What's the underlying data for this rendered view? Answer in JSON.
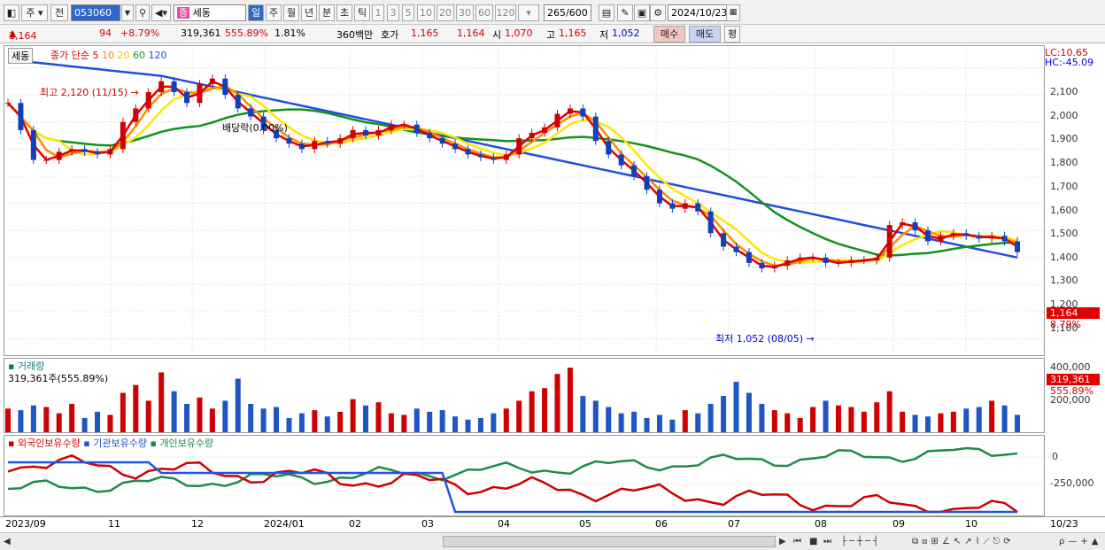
{
  "toolbar": {
    "period_type": "주",
    "prev": "전",
    "code": "053060",
    "name": "세동",
    "periods": [
      "일",
      "주",
      "월",
      "년",
      "분",
      "초",
      "틱"
    ],
    "numbers": [
      "1",
      "3",
      "5",
      "10",
      "20",
      "30",
      "60",
      "120"
    ],
    "count": "265",
    "count_total": "/600",
    "date": "2024/10/23"
  },
  "quote": {
    "price": "1,164",
    "change": "94",
    "change_pct": "+8.79%",
    "volume": "319,361",
    "volume_pct": "555.89%",
    "turnover": "1.81%",
    "amount": "360백만",
    "hoga_label": "호가",
    "ask": "1,165",
    "bid": "1,164",
    "open_label": "시",
    "open": "1,070",
    "high_label": "고",
    "high": "1,165",
    "low_label": "저",
    "low": "1,052",
    "buy": "매수",
    "sell": "매도",
    "avg": "평"
  },
  "price_panel": {
    "tab": "세동",
    "legend_label": "종가 단순",
    "ma": [
      "5",
      "10",
      "20",
      "60",
      "120"
    ],
    "ma_colors": [
      "#e00000",
      "#ff8c00",
      "#ffe600",
      "#12931e",
      "#1f4fe0"
    ],
    "lc": "LC:10.65",
    "hc": "HC:-45.09",
    "high_note": "최고 2,120 (11/15)",
    "low_note": "최저 1,052 (08/05)",
    "div_note": "배당락(0.00%)",
    "current_price": "1,164",
    "current_pct": "8.79%",
    "y_labels": [
      "2,100",
      "2,000",
      "1,900",
      "1,800",
      "1,700",
      "1,600",
      "1,500",
      "1,400",
      "1,300",
      "1,200",
      "1,100"
    ]
  },
  "volume_panel": {
    "title": "거래량",
    "value": "319,361주(555.89%)",
    "y_labels": [
      "400,000",
      "200,000"
    ],
    "current": "319,361",
    "current_pct": "555.89%"
  },
  "holding_panel": {
    "foreign": "외국인보유수량",
    "inst": "기관보유수량",
    "indiv": "개인보유수량",
    "y_labels": [
      "0",
      "-250,000"
    ]
  },
  "x_labels": [
    "2023/09",
    "11",
    "12",
    "2024/01",
    "02",
    "03",
    "04",
    "05",
    "06",
    "07",
    "08",
    "09",
    "10",
    "10/23"
  ],
  "chart_data": {
    "type": "line",
    "title": "세동 (053060)",
    "ylim": [
      1040,
      2180
    ],
    "x_points": 80,
    "close": [
      1970,
      1870,
      1760,
      1760,
      1790,
      1800,
      1790,
      1780,
      1800,
      1900,
      1950,
      2010,
      2050,
      2010,
      1970,
      2040,
      2060,
      2000,
      1950,
      1920,
      1870,
      1840,
      1820,
      1800,
      1830,
      1820,
      1840,
      1870,
      1850,
      1870,
      1890,
      1890,
      1860,
      1840,
      1820,
      1800,
      1780,
      1770,
      1760,
      1780,
      1840,
      1860,
      1880,
      1930,
      1950,
      1920,
      1830,
      1780,
      1740,
      1700,
      1650,
      1600,
      1580,
      1600,
      1570,
      1490,
      1440,
      1420,
      1380,
      1360,
      1370,
      1390,
      1400,
      1400,
      1380,
      1380,
      1390,
      1390,
      1400,
      1520,
      1530,
      1500,
      1460,
      1480,
      1490,
      1480,
      1470,
      1480,
      1460,
      1420
    ],
    "volume_k": [
      150,
      140,
      170,
      160,
      120,
      180,
      90,
      130,
      110,
      250,
      300,
      200,
      380,
      260,
      180,
      220,
      150,
      200,
      340,
      180,
      150,
      160,
      90,
      120,
      140,
      100,
      130,
      210,
      170,
      190,
      120,
      110,
      150,
      130,
      140,
      100,
      80,
      90,
      120,
      150,
      200,
      260,
      280,
      370,
      410,
      230,
      200,
      160,
      120,
      130,
      90,
      110,
      80,
      140,
      120,
      180,
      230,
      320,
      250,
      180,
      140,
      120,
      90,
      160,
      200,
      170,
      160,
      130,
      190,
      260,
      130,
      110,
      100,
      120,
      130,
      150,
      160,
      200,
      170,
      110
    ],
    "ma120": [
      2130,
      2125,
      2120,
      2115,
      2110,
      2105,
      2100,
      2095,
      2090,
      2085,
      2080,
      2075,
      2070,
      2060,
      2050,
      2040,
      2030,
      2020,
      2010,
      2000,
      1990,
      1980,
      1970,
      1960,
      1950,
      1940,
      1930,
      1920,
      1910,
      1900,
      1890,
      1880,
      1870,
      1860,
      1850,
      1840,
      1830,
      1820,
      1810,
      1800,
      1790,
      1780,
      1770,
      1760,
      1750,
      1740,
      1730,
      1720,
      1710,
      1700,
      1690,
      1680,
      1670,
      1660,
      1650,
      1640,
      1630,
      1620,
      1610,
      1600,
      1590,
      1580,
      1570,
      1560,
      1550,
      1540,
      1530,
      1520,
      1510,
      1500,
      1490,
      1480,
      1470,
      1460,
      1450,
      1440,
      1430,
      1420,
      1410,
      1400
    ]
  }
}
